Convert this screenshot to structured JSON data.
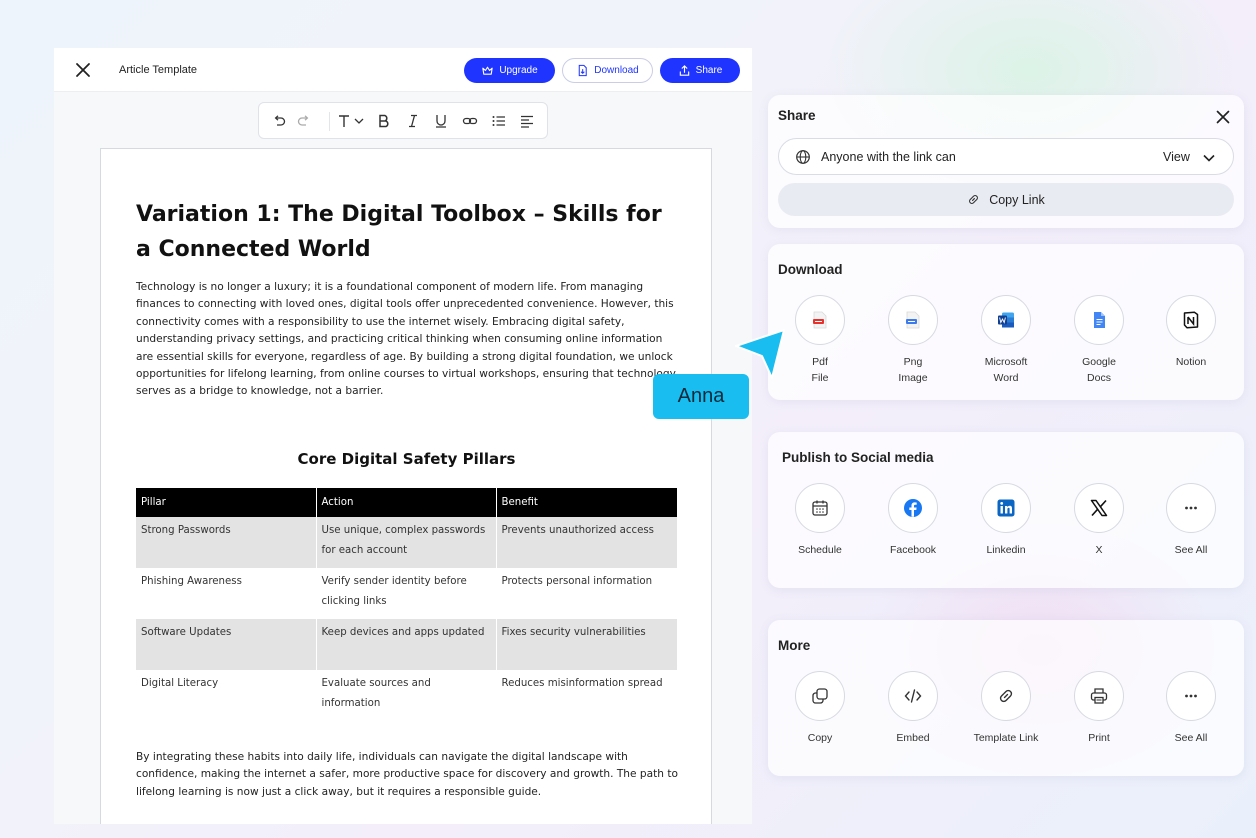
{
  "editor": {
    "doc_title": "Article Template",
    "buttons": {
      "upgrade": "Upgrade",
      "download": "Download",
      "share": "Share"
    },
    "toolbar_icons": [
      "undo-icon",
      "redo-icon",
      "text-style-icon",
      "chevron-down-icon",
      "bold-icon",
      "italic-icon",
      "underline-icon",
      "link-icon",
      "bullet-list-icon",
      "align-left-icon"
    ]
  },
  "document": {
    "heading": "Variation 1: The Digital Toolbox – Skills for a Connected World",
    "intro": "Technology is no longer a luxury; it is a foundational component of modern life. From managing finances to connecting with loved ones, digital tools offer unprecedented convenience. However, this connectivity comes with a responsibility to use the internet wisely. Embracing digital safety, understanding privacy settings, and practicing critical thinking when consuming online information are essential skills for everyone, regardless of age. By building a strong digital foundation, we unlock opportunities for lifelong learning, from online courses to virtual workshops, ensuring that technology serves as a bridge to knowledge, not a barrier.",
    "subheading": "Core Digital Safety Pillars",
    "table": {
      "headers": [
        "Pillar",
        "Action",
        "Benefit"
      ],
      "rows": [
        [
          "Strong Passwords",
          "Use unique, complex passwords for each account",
          "Prevents unauthorized access"
        ],
        [
          "Phishing Awareness",
          "Verify sender identity before clicking links",
          "Protects personal information"
        ],
        [
          "Software Updates",
          "Keep devices and apps updated",
          "Fixes security vulnerabilities"
        ],
        [
          "Digital Literacy",
          "Evaluate sources and information",
          "Reduces misinformation spread"
        ]
      ]
    },
    "outro": "By integrating these habits into daily life, individuals can navigate the digital landscape with confidence, making the internet a safer, more productive space for discovery and growth. The path to lifelong learning is now just a click away, but it requires a responsible guide."
  },
  "share": {
    "title": "Share",
    "access_label": "Anyone with the link can",
    "access_value": "View",
    "copy_link": "Copy Link"
  },
  "download": {
    "title": "Download",
    "options": [
      {
        "label": "Pdf\nFile",
        "icon": "pdf-file-icon"
      },
      {
        "label": "Png\nImage",
        "icon": "png-image-icon"
      },
      {
        "label": "Microsoft\nWord",
        "icon": "microsoft-word-icon"
      },
      {
        "label": "Google\nDocs",
        "icon": "google-docs-icon"
      },
      {
        "label": "Notion",
        "icon": "notion-icon"
      }
    ]
  },
  "social": {
    "title": "Publish to Social media",
    "options": [
      {
        "label": "Schedule",
        "icon": "calendar-icon"
      },
      {
        "label": "Facebook",
        "icon": "facebook-icon"
      },
      {
        "label": "Linkedin",
        "icon": "linkedin-icon"
      },
      {
        "label": "X",
        "icon": "x-icon"
      },
      {
        "label": "See All",
        "icon": "more-icon"
      }
    ]
  },
  "more": {
    "title": "More",
    "options": [
      {
        "label": "Copy",
        "icon": "copy-icon"
      },
      {
        "label": "Embed",
        "icon": "embed-code-icon"
      },
      {
        "label": "Template Link",
        "icon": "link-icon"
      },
      {
        "label": "Print",
        "icon": "printer-icon"
      },
      {
        "label": "See All",
        "icon": "more-icon"
      }
    ]
  },
  "collaborator": {
    "name": "Anna"
  },
  "colors": {
    "primary": "#1f35ff",
    "cursor": "#19bdf0",
    "table_header": "#000000",
    "table_shade": "#e3e3e3"
  }
}
